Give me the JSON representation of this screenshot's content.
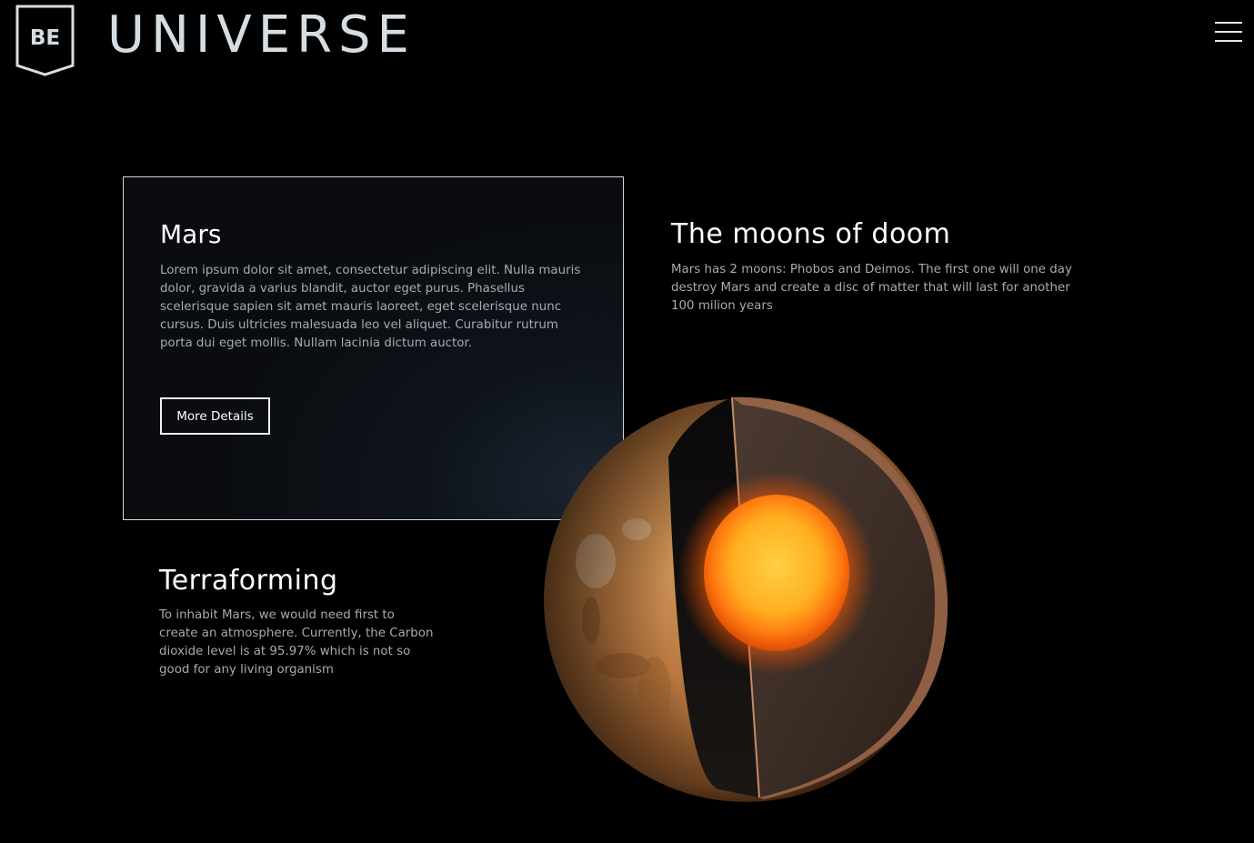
{
  "header": {
    "logo_text": "BE",
    "brand": "UNIVERSE",
    "menu_icon": "hamburger-menu-icon"
  },
  "card": {
    "title": "Mars",
    "body": "Lorem ipsum dolor sit amet, consectetur adipiscing elit. Nulla mauris dolor, gravida a varius blandit, auctor eget purus. Phasellus scelerisque sapien sit amet mauris laoreet, eget scelerisque nunc cursus. Duis ultricies malesuada leo vel aliquet. Curabitur rutrum porta dui eget mollis. Nullam lacinia dictum auctor.",
    "button_label": "More Details"
  },
  "moons": {
    "title": "The moons of doom",
    "body": "Mars has 2 moons: Phobos and Deimos. The first one will one day destroy Mars and create a disc of matter that will last for another 100 milion years"
  },
  "terraforming": {
    "title": "Terraforming",
    "body": "To inhabit Mars, we would need first to create an atmosphere. Currently, the Carbon dioxide level is at 95.97% which is not so good for any living organism"
  },
  "colors": {
    "background": "#000000",
    "text_primary": "#ffffff",
    "text_secondary": "#a5abb2",
    "brand": "#d6dde2",
    "mars_surface": "#b9783f",
    "core_glow": "#ffb020"
  }
}
